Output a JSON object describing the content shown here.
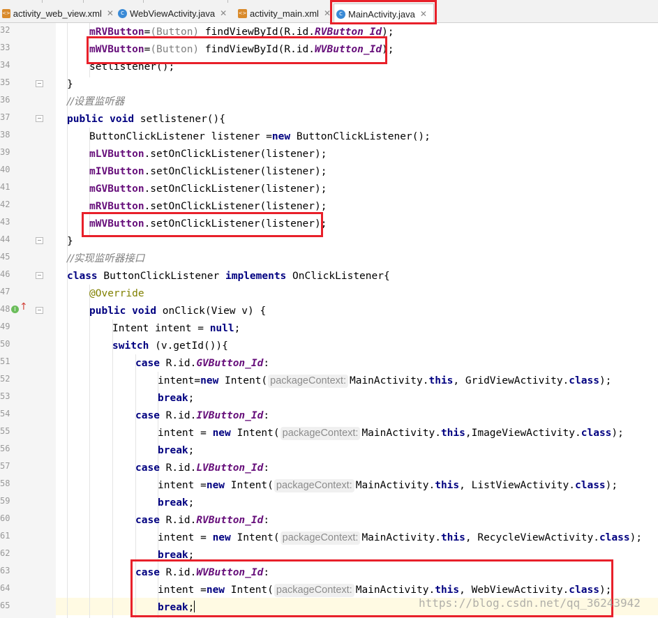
{
  "tabs": [
    {
      "label": "activity_web_view.xml",
      "type": "xml"
    },
    {
      "label": "WebViewActivity.java",
      "type": "java"
    },
    {
      "label": "activity_main.xml",
      "type": "xml"
    },
    {
      "label": "MainActivity.java",
      "type": "java",
      "active": true
    }
  ],
  "gutter": {
    "line_numbers": [
      "32",
      "33",
      "34",
      "35",
      "36",
      "37",
      "38",
      "39",
      "40",
      "41",
      "42",
      "43",
      "44",
      "45",
      "46",
      "47",
      "48",
      "49",
      "50",
      "51",
      "52",
      "53",
      "54",
      "55",
      "56",
      "57",
      "58",
      "59",
      "60",
      "61",
      "62",
      "63",
      "64",
      "65"
    ]
  },
  "code": {
    "l32": {
      "field": "mRVButton",
      "op": "=",
      "cast": "(Button)",
      "call": " findViewById(R.id.",
      "const": "RVButton_Id",
      "end": ");"
    },
    "l33": {
      "field": "mWVButton",
      "op": "=",
      "cast": "(Button)",
      "call": " findViewById(R.id.",
      "const": "WVButton_Id",
      "end": ");"
    },
    "l34": "setlistener();",
    "l35": "}",
    "l36": "//设置监听器",
    "l37": {
      "kw1": "public",
      "kw2": "void",
      "rest": " setlistener(){"
    },
    "l38": {
      "pre": "ButtonClickListener listener =",
      "kw": "new",
      "post": " ButtonClickListener();"
    },
    "l39": {
      "field": "mLVButton",
      "call": ".setOnClickListener(listener);"
    },
    "l40": {
      "field": "mIVButton",
      "call": ".setOnClickListener(listener);"
    },
    "l41": {
      "field": "mGVButton",
      "call": ".setOnClickListener(listener);"
    },
    "l42": {
      "field": "mRVButton",
      "call": ".setOnClickListener(listener);"
    },
    "l43": {
      "field": "mWVButton",
      "call": ".setOnClickListener(listener);"
    },
    "l44": "}",
    "l45": "//实现监听器接口",
    "l46": {
      "kw1": "class",
      "mid": " ButtonClickListener ",
      "kw2": "implements",
      "rest": " OnClickListener{"
    },
    "l47": "@Override",
    "l48": {
      "kw1": "public",
      "kw2": "void",
      "rest": " onClick(View v) {"
    },
    "l49": {
      "pre": "Intent intent = ",
      "kw": "null",
      "post": ";"
    },
    "l50": {
      "kw": "switch",
      "rest": " (v.getId()){"
    },
    "case_kw": "case",
    "break_kw": "break",
    "new_kw": "new",
    "this_kw": "this",
    "class_kw": "class",
    "hint": "packageContext:",
    "cases": [
      {
        "prefix": " R.id.",
        "const": "GVButton_Id",
        "suffix": ":",
        "intent_pre": "intent=",
        "intent_mid": " Intent(",
        "ctx": "MainActivity.",
        "sep": ", ",
        "target": "GridViewActivity.",
        "end": ");"
      },
      {
        "prefix": " R.id.",
        "const": "IVButton_Id",
        "suffix": ":",
        "intent_pre": "intent = ",
        "intent_mid": " Intent(",
        "ctx": "MainActivity.",
        "sep": ",",
        "target": "ImageViewActivity.",
        "end": ");"
      },
      {
        "prefix": " R.id.",
        "const": "LVButton_Id",
        "suffix": ":",
        "intent_pre": "intent =",
        "intent_mid": " Intent(",
        "ctx": "MainActivity.",
        "sep": ", ",
        "target": "ListViewActivity.",
        "end": ");"
      },
      {
        "prefix": " R.id.",
        "const": "RVButton_Id",
        "suffix": ":",
        "intent_pre": "intent = ",
        "intent_mid": " Intent(",
        "ctx": "MainActivity.",
        "sep": ", ",
        "target": "RecycleViewActivity.",
        "end": ");"
      },
      {
        "prefix": " R.id.",
        "const": "WVButton_Id",
        "suffix": ":",
        "intent_pre": "intent =",
        "intent_mid": " Intent(",
        "ctx": "MainActivity.",
        "sep": ", ",
        "target": "WebViewActivity.",
        "end": ");"
      }
    ]
  },
  "watermark": "https://blog.csdn.net/qq_36243942",
  "colors": {
    "keyword": "#000080",
    "field": "#660e7a",
    "comment": "#808080",
    "annotation": "#808000",
    "highlight_box": "#e8202a"
  }
}
